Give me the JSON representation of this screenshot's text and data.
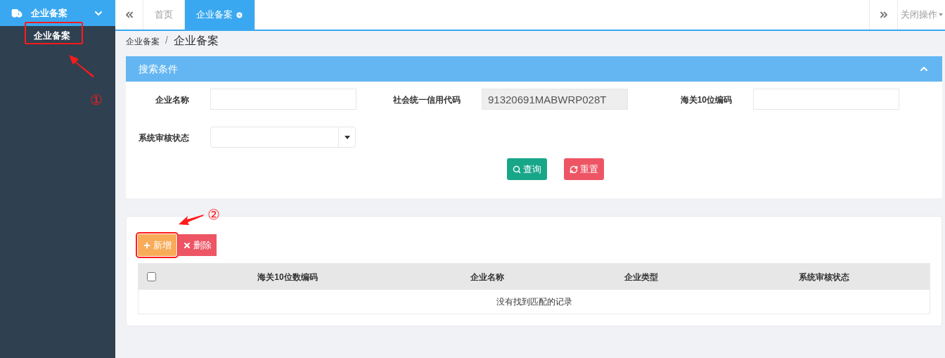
{
  "sidebar": {
    "menu": {
      "label": "企业备案",
      "expanded": true,
      "children": [
        {
          "label": "企业备案",
          "selected": true
        }
      ]
    }
  },
  "tabs_bar": {
    "tabs": [
      {
        "label": "首页",
        "selected": false,
        "closable": false
      },
      {
        "label": "企业备案",
        "selected": true,
        "closable": true
      }
    ],
    "close_menu": "关闭操作"
  },
  "breadcrumb": {
    "parent": "企业备案",
    "separator": "/",
    "current": "企业备案"
  },
  "search_panel": {
    "title": "搜索条件",
    "expanded": true,
    "fields": [
      {
        "kind": "text",
        "label": "企业名称",
        "disabled": false
      },
      {
        "kind": "text",
        "label": "社会统一信用代码",
        "value": "91320691MABWRP028T",
        "disabled": true
      },
      {
        "kind": "text",
        "label": "海关10位编码",
        "disabled": false
      },
      {
        "kind": "select",
        "label": "系统审核状态"
      }
    ],
    "buttons": [
      {
        "kind": "search",
        "label": "查询"
      },
      {
        "kind": "reset",
        "label": "重置"
      }
    ]
  },
  "toolbar": [
    {
      "kind": "add",
      "label": "新增",
      "highlighted": true
    },
    {
      "kind": "delete",
      "label": "删除",
      "highlighted": false
    }
  ],
  "table": {
    "select_all": false,
    "columns": [
      "海关10位数编码",
      "企业名称",
      "企业类型",
      "系统审核状态"
    ],
    "empty_text": "没有找到匹配的记录"
  },
  "annotations": [
    {
      "label": "①"
    },
    {
      "label": "②"
    }
  ]
}
